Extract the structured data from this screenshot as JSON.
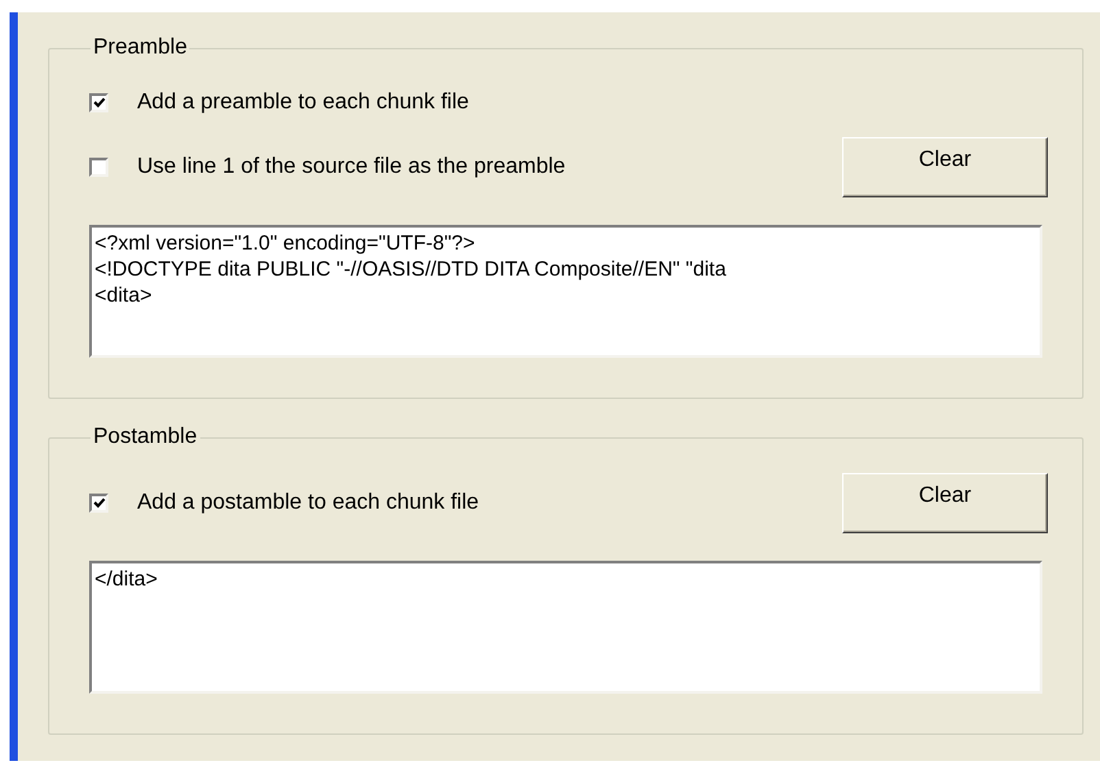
{
  "groups": [
    {
      "title": "Preamble",
      "options": [
        {
          "label": "Add a preamble to each chunk file",
          "checked": true
        },
        {
          "label": "Use line 1 of the source file as the preamble",
          "checked": false,
          "button": "Clear"
        }
      ],
      "text": "<?xml version=\"1.0\" encoding=\"UTF-8\"?>\n<!DOCTYPE dita PUBLIC \"-//OASIS//DTD DITA Composite//EN\" \"dita\n<dita>"
    },
    {
      "title": "Postamble",
      "options": [
        {
          "label": "Add a postamble to each chunk file",
          "checked": true,
          "button": "Clear"
        }
      ],
      "text": "</dita>"
    }
  ]
}
